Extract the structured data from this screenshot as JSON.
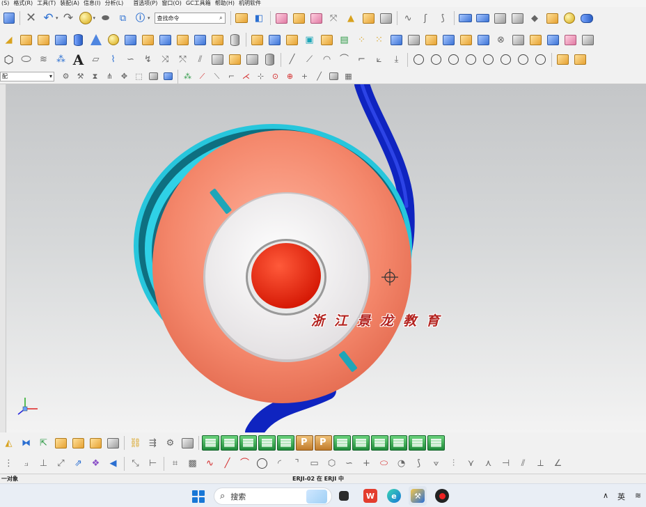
{
  "menu": [
    "(S)",
    "格式(R)",
    "工具(T)",
    "装配(A)",
    "信息(I)",
    "分析(L)",
    "首选项(P)",
    "窗口(O)",
    "GC工具箱",
    "帮助(H)",
    "机明软件"
  ],
  "toolbar": {
    "search_label": "查找命令",
    "selection_filter_value": "配"
  },
  "watermark": "浙江景龙教育",
  "status": {
    "prompt": "一对象",
    "part": "ERJI-02 在 ERJI 中"
  },
  "taskbar": {
    "search_label": "搜索",
    "ime": "英"
  },
  "colors": {
    "viewport_top": "#c4c6c8",
    "viewport_bottom": "#f3f3f3",
    "body_coral": "#f2866a",
    "inner_white": "#f3f1f1",
    "button_red": "#ea2a10",
    "ring_cyan": "#27c6dc",
    "cable_blue": "#0f24c0",
    "watermark_red": "#b3221e"
  }
}
